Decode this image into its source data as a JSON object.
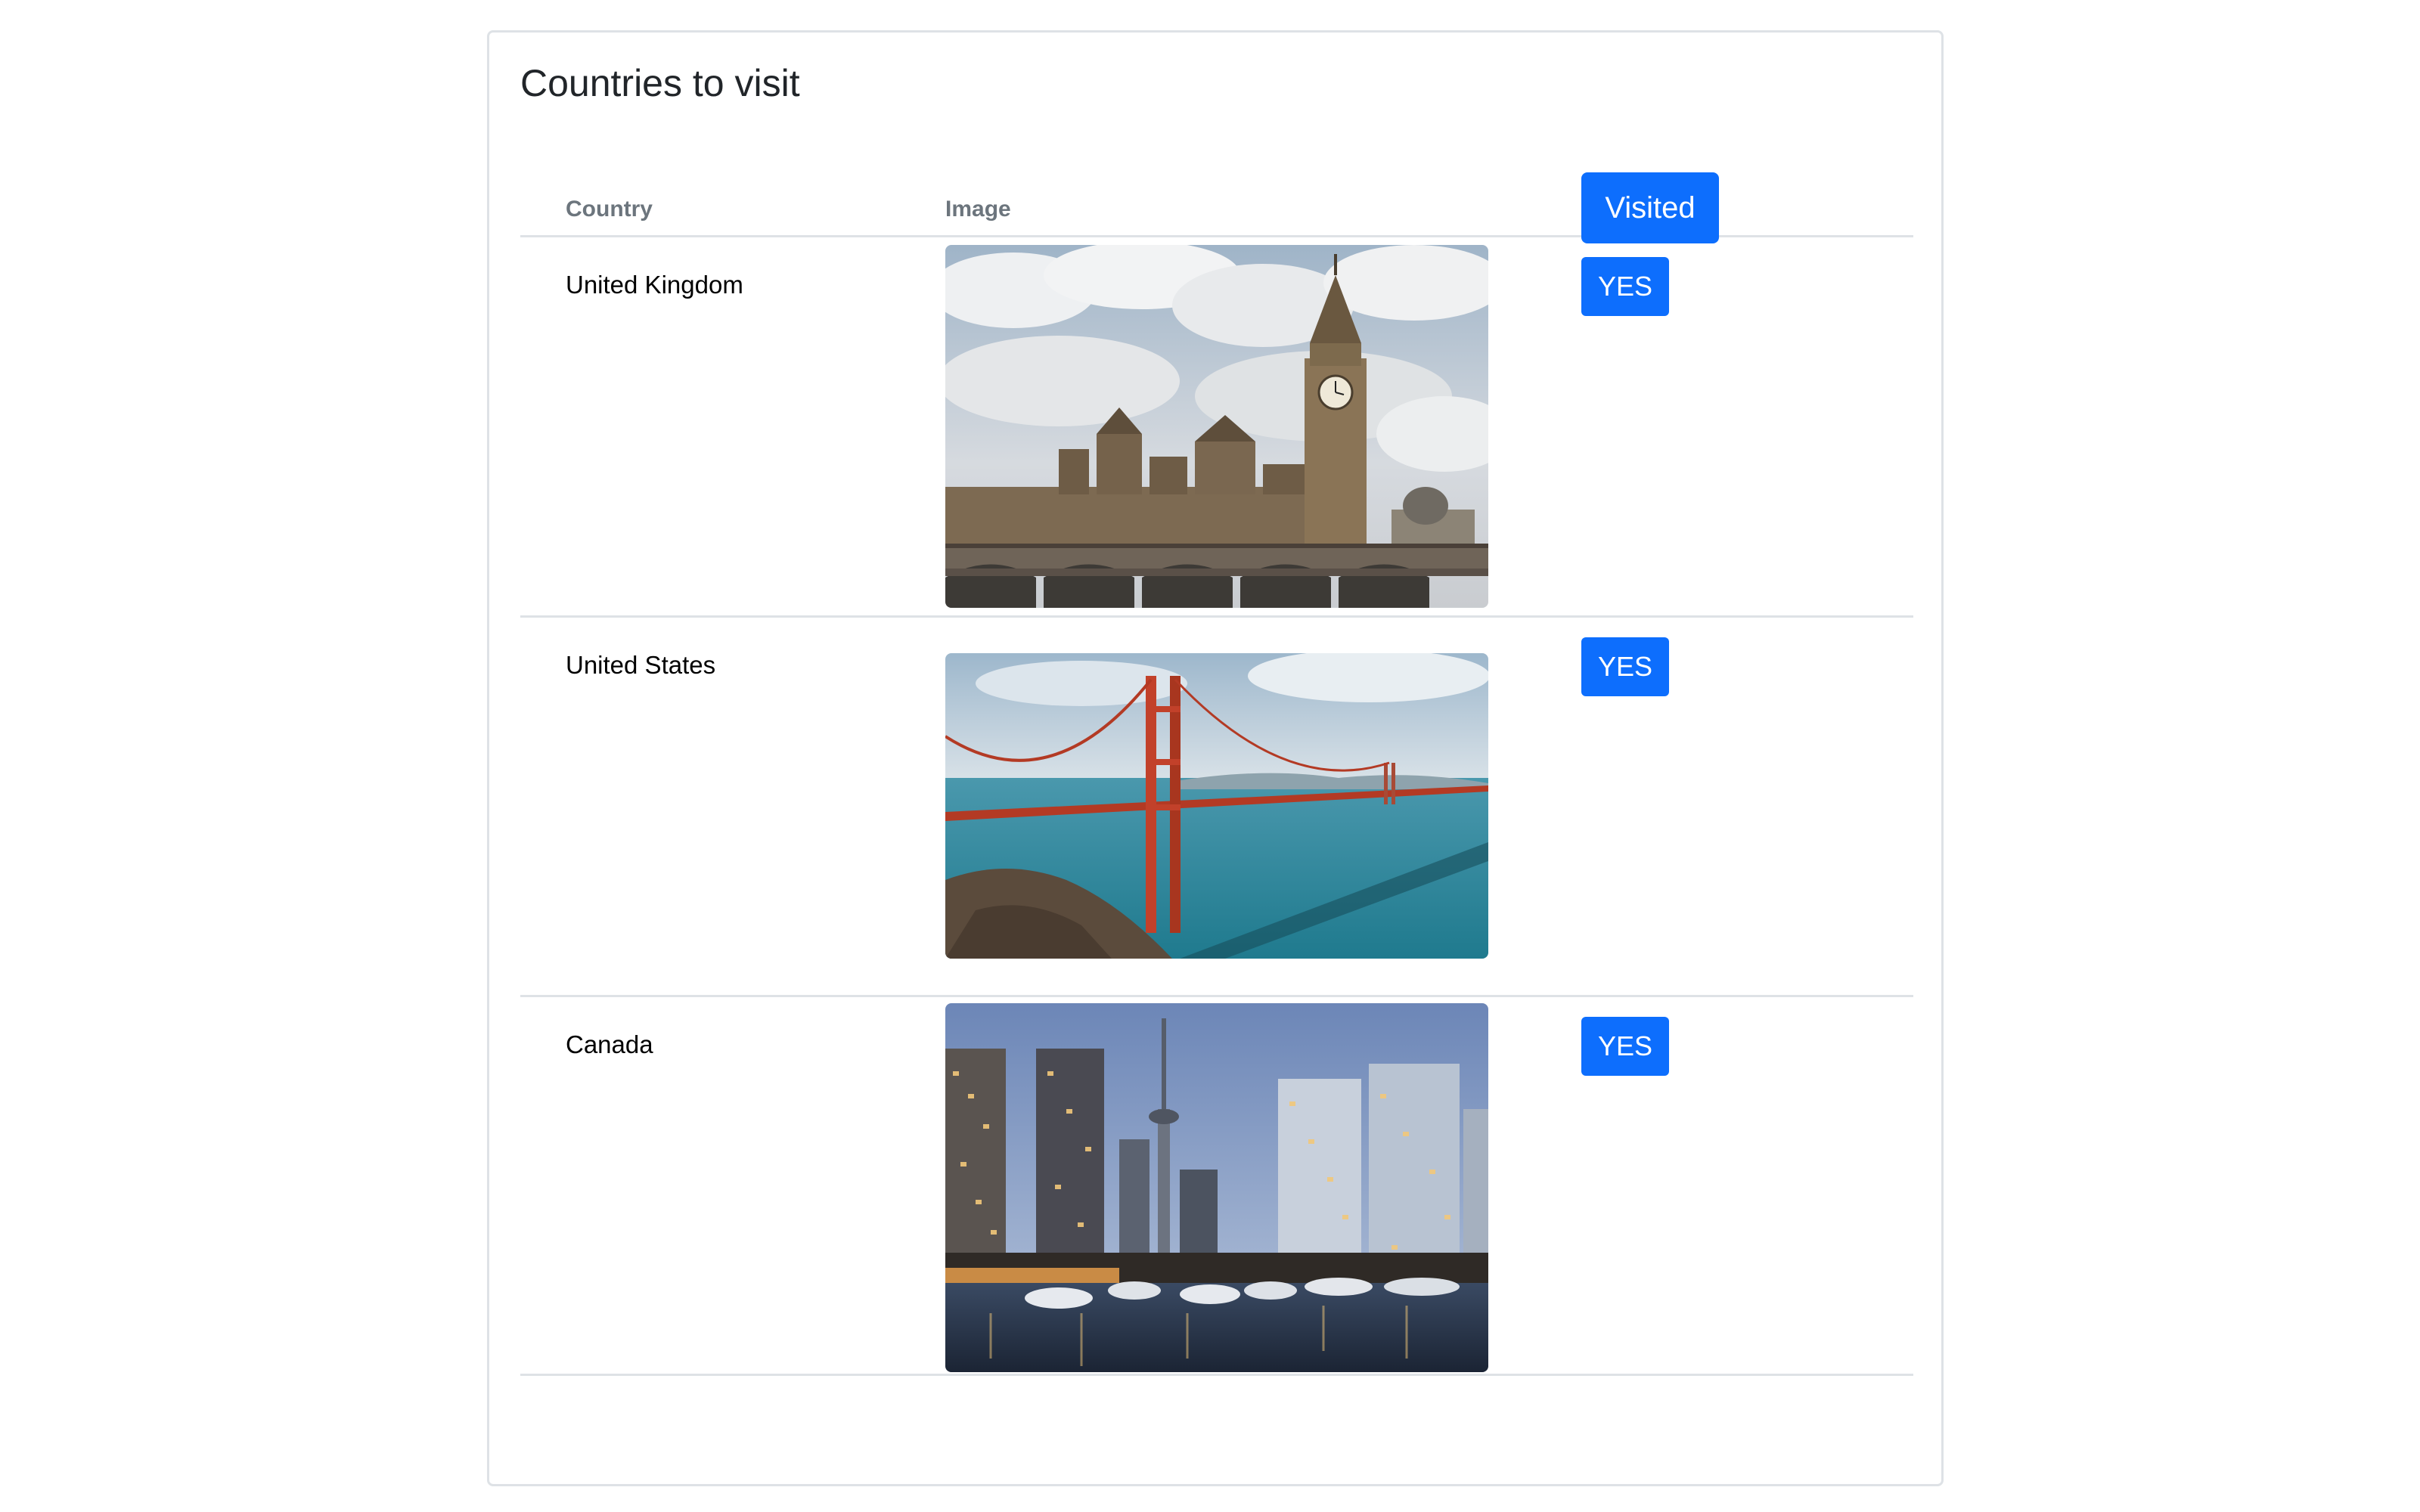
{
  "card": {
    "title": "Countries to visit"
  },
  "table": {
    "headers": {
      "country": "Country",
      "image": "Image",
      "visited": "Visited"
    },
    "rows": [
      {
        "country": "United Kingdom",
        "image": "big-ben-westminster-photo",
        "visited": "YES"
      },
      {
        "country": "United States",
        "image": "golden-gate-bridge-photo",
        "visited": "YES"
      },
      {
        "country": "Canada",
        "image": "toronto-cn-tower-marina-photo",
        "visited": "YES"
      }
    ]
  },
  "colors": {
    "primary": "#0d6efd",
    "border": "#dee2e6",
    "header_text": "#6c757d"
  }
}
